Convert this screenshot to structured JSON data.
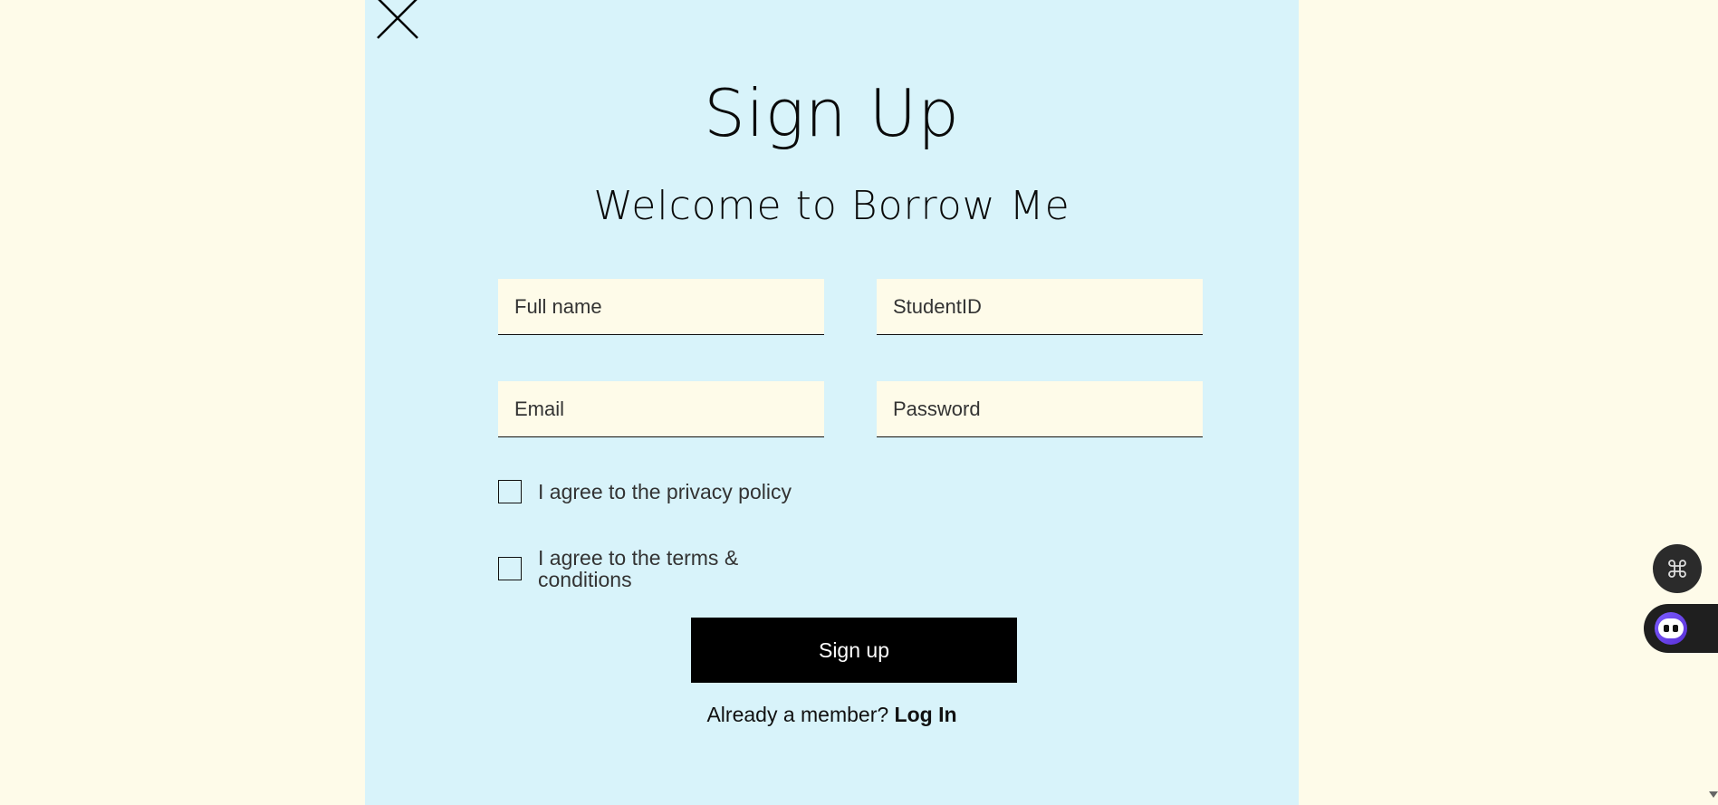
{
  "modal": {
    "title": "Sign Up",
    "subtitle": "Welcome to Borrow Me",
    "close_icon": "close-icon"
  },
  "form": {
    "full_name_placeholder": "Full name",
    "student_id_placeholder": "StudentID",
    "email_placeholder": "Email",
    "password_placeholder": "Password",
    "privacy_label": "I agree to the privacy policy",
    "terms_label": "I agree to the terms & conditions",
    "submit_label": "Sign up"
  },
  "footer": {
    "member_text": "Already a member?",
    "login_label": "Log In"
  },
  "floating": {
    "command_icon": "command-icon",
    "assistant_icon": "assistant-bot-icon"
  },
  "colors": {
    "page_background": "#fefbe9",
    "modal_background": "#d8f3fa",
    "field_background": "#fefbe9",
    "button_background": "#000000",
    "button_text": "#ffffff"
  }
}
